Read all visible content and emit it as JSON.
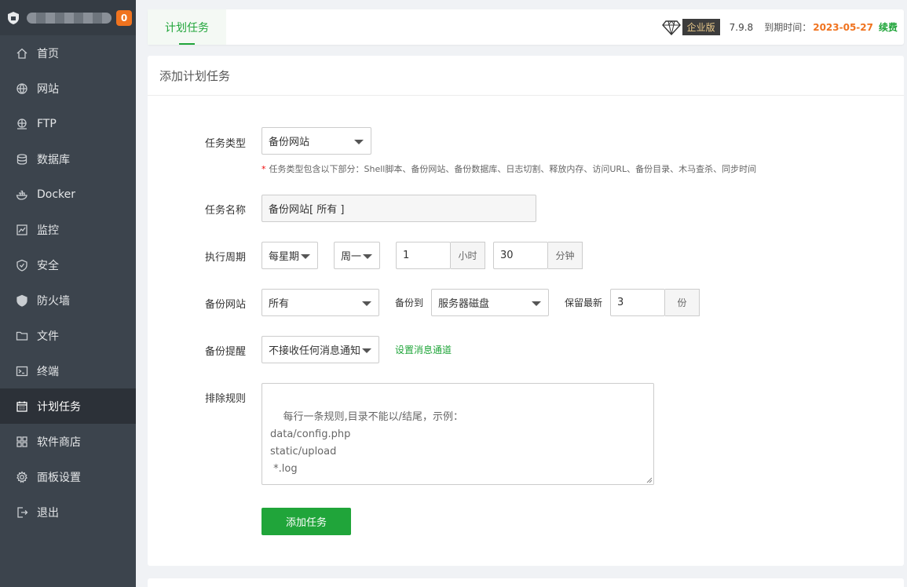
{
  "sidebar": {
    "badge": "0",
    "items": [
      {
        "label": "首页",
        "icon": "home-icon"
      },
      {
        "label": "网站",
        "icon": "globe-icon"
      },
      {
        "label": "FTP",
        "icon": "ftp-icon"
      },
      {
        "label": "数据库",
        "icon": "database-icon"
      },
      {
        "label": "Docker",
        "icon": "docker-icon"
      },
      {
        "label": "监控",
        "icon": "monitor-icon"
      },
      {
        "label": "安全",
        "icon": "shield-icon"
      },
      {
        "label": "防火墙",
        "icon": "firewall-icon"
      },
      {
        "label": "文件",
        "icon": "folder-icon"
      },
      {
        "label": "终端",
        "icon": "terminal-icon"
      },
      {
        "label": "计划任务",
        "icon": "calendar-icon",
        "active": true
      },
      {
        "label": "软件商店",
        "icon": "apps-icon"
      },
      {
        "label": "面板设置",
        "icon": "settings-icon"
      },
      {
        "label": "退出",
        "icon": "logout-icon"
      }
    ]
  },
  "topbar": {
    "tab": "计划任务",
    "edition": "企业版",
    "version": "7.9.8",
    "expire_label": "到期时间：",
    "expire_date": "2023-05-27",
    "renew": "续费"
  },
  "form": {
    "title": "添加计划任务",
    "task_type_label": "任务类型",
    "task_type_value": "备份网站",
    "hint_star": "*",
    "hint": "任务类型包含以下部分：Shell脚本、备份网站、备份数据库、日志切割、释放内存、访问URL、备份目录、木马查杀、同步时间",
    "task_name_label": "任务名称",
    "task_name_value": "备份网站[ 所有 ]",
    "cycle_label": "执行周期",
    "cycle_type": "每星期",
    "cycle_day": "周一",
    "hour_value": "1",
    "hour_unit": "小时",
    "minute_value": "30",
    "minute_unit": "分钟",
    "backup_site_label": "备份网站",
    "backup_site_value": "所有",
    "backup_to_label": "备份到",
    "backup_to_value": "服务器磁盘",
    "keep_label": "保留最新",
    "keep_value": "3",
    "keep_unit": "份",
    "notify_label": "备份提醒",
    "notify_value": "不接收任何消息通知",
    "notify_link": "设置消息通道",
    "exclude_label": "排除规则",
    "exclude_placeholder": "每行一条规则,目录不能以/结尾，示例：\ndata/config.php\nstatic/upload\n *.log",
    "submit": "添加任务"
  },
  "colors": {
    "accent": "#20a53a",
    "warning": "#f0731f",
    "sidebar_bg": "#3c444d"
  }
}
